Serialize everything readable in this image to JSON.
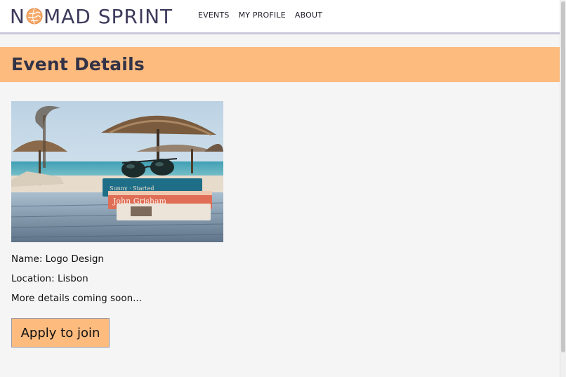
{
  "header": {
    "logo_left": "N",
    "logo_right": "MAD SPRINT",
    "nav": [
      "EVENTS",
      "MY PROFILE",
      "ABOUT"
    ]
  },
  "banner": {
    "title": "Event Details"
  },
  "event": {
    "name_line": "Name: Logo Design",
    "location_line": "Location: Lisbon",
    "details_line": "More details coming soon...",
    "image_book_titles": [
      "John Grisham"
    ]
  },
  "actions": {
    "apply_label": "Apply to join"
  },
  "colors": {
    "accent": "#fdbb7e",
    "brand_text": "#3d3a5c",
    "nav_border": "#cbc8db",
    "page_bg": "#f5f5f6"
  },
  "icons": {
    "logo_globe": "globe-icon"
  }
}
